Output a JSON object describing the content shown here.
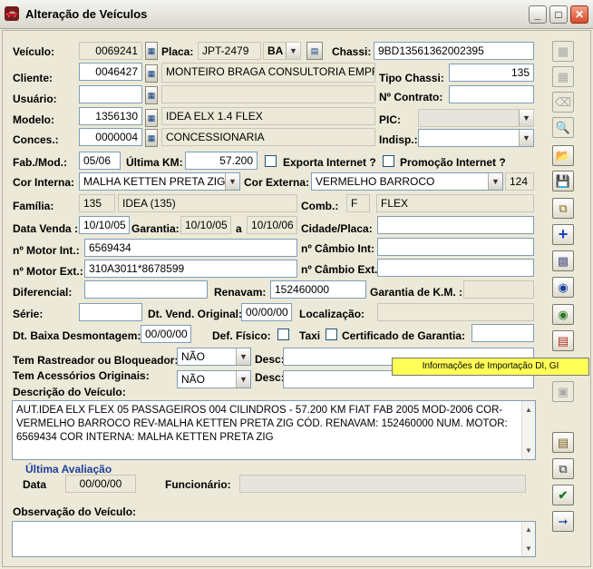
{
  "window": {
    "title": "Alteração de Veículos",
    "minimize": "_",
    "maximize": "□",
    "close": "✕",
    "icon": "car-icon"
  },
  "fields": {
    "veiculo": {
      "label": "Veículo:",
      "value": "0069241"
    },
    "placa": {
      "label": "Placa:",
      "value": "JPT-2479",
      "uf": "BA"
    },
    "chassi": {
      "label": "Chassi:",
      "value": "9BD13561362002395"
    },
    "cliente": {
      "label": "Cliente:",
      "code": "0046427",
      "name": "MONTEIRO BRAGA CONSULTORIA EMPR"
    },
    "tipo_chassi": {
      "label": "Tipo Chassi:",
      "value": "135"
    },
    "usuario": {
      "label": "Usuário:",
      "code": "",
      "name": ""
    },
    "contrato": {
      "label": "Nº Contrato:",
      "value": ""
    },
    "modelo": {
      "label": "Modelo:",
      "code": "1356130",
      "name": "IDEA ELX 1.4 FLEX"
    },
    "pic": {
      "label": "PIC:",
      "value": ""
    },
    "conces": {
      "label": "Conces.:",
      "code": "0000004",
      "name": "CONCESSIONARIA"
    },
    "indisp": {
      "label": "Indisp.:",
      "value": ""
    },
    "fab_mod": {
      "label": "Fab./Mod.:",
      "value": "05/06"
    },
    "ultima_km": {
      "label": "Última KM:",
      "value": "57.200"
    },
    "exporta": {
      "label": "Exporta Internet ?"
    },
    "promocao": {
      "label": "Promoção Internet ?"
    },
    "cor_interna": {
      "label": "Cor Interna:",
      "value": "MALHA KETTEN PRETA ZIG"
    },
    "cor_externa": {
      "label": "Cor Externa:",
      "value": "VERMELHO BARROCO",
      "code": "124"
    },
    "familia": {
      "label": "Família:",
      "code": "135",
      "name": "IDEA (135)"
    },
    "comb": {
      "label": "Comb.:",
      "code": "F",
      "name": "FLEX"
    },
    "data_venda": {
      "label": "Data Venda :",
      "value": "10/10/05"
    },
    "garantia": {
      "label": "Garantia:",
      "from": "10/10/05",
      "sep": "a",
      "to": "10/10/06"
    },
    "cidade_placa": {
      "label": "Cidade/Placa:",
      "value": ""
    },
    "motor_int": {
      "label": "nº Motor Int.:",
      "value": "6569434"
    },
    "cambio_int": {
      "label": "nº Câmbio Int:",
      "value": ""
    },
    "motor_ext": {
      "label": "nº Motor Ext.:",
      "value": "310A3011*8678599"
    },
    "cambio_ext": {
      "label": "nº Câmbio Ext.:",
      "value": ""
    },
    "diferencial": {
      "label": "Diferencial:",
      "value": ""
    },
    "renavam": {
      "label": "Renavam:",
      "value": "152460000"
    },
    "garantia_km": {
      "label": "Garantia de K.M. :",
      "value": ""
    },
    "serie": {
      "label": "Série:",
      "value": ""
    },
    "dt_vend_original": {
      "label": "Dt. Vend. Original:",
      "value": "00/00/00"
    },
    "localizacao": {
      "label": "Localização:",
      "value": ""
    },
    "dt_baixa": {
      "label": "Dt. Baixa Desmontagem:",
      "value": "00/00/00"
    },
    "def_fisico": {
      "label": "Def. Físico:"
    },
    "taxi": {
      "label": "Taxi"
    },
    "certificado": {
      "label": "Certificado de Garantia:",
      "value": ""
    },
    "rastreador": {
      "label": "Tem Rastreador ou Bloqueador:",
      "value": "NÃO",
      "desc_label": "Desc:",
      "desc": ""
    },
    "acessorios": {
      "label": "Tem Acessórios Originais:",
      "value": "NÃO",
      "desc_label": "Desc:",
      "desc": ""
    },
    "descricao": {
      "label": "Descrição do Veículo:",
      "value": "AUT.IDEA ELX FLEX 05 PASSAGEIROS 004 CILINDROS - 57.200 KM FIAT FAB 2005 MOD-2006 COR-VERMELHO BARROCO REV-MALHA KETTEN PRETA ZIG CÓD. RENAVAM: 152460000 NUM. MOTOR: 6569434 COR INTERNA: MALHA KETTEN PRETA ZIG"
    },
    "ultima_avaliacao": {
      "label": "Última Avaliação",
      "data_label": "Data",
      "data": "00/00/00",
      "func_label": "Funcionário:",
      "func": ""
    },
    "observacao": {
      "label": "Observação do Veículo:",
      "value": ""
    }
  },
  "tooltip": "Informações de Importação DI, GI",
  "toolbar": [
    "grid-add-icon",
    "grid-edit-icon",
    "eraser-icon",
    "preview-icon",
    "open-folder-icon",
    "save-disk-icon",
    "copy-icon",
    "add-plus-icon",
    "photo-list-icon",
    "camera-icon",
    "globe-icon",
    "import-info-icon",
    "tool-icon",
    "stamp-icon",
    "report-icon",
    "duplicate-icon",
    "check-save-icon",
    "exit-door-icon"
  ],
  "colors": {
    "accent": "#1f3f9a",
    "tooltip": "#ffff55",
    "add_icon": "#1b3fc7"
  }
}
